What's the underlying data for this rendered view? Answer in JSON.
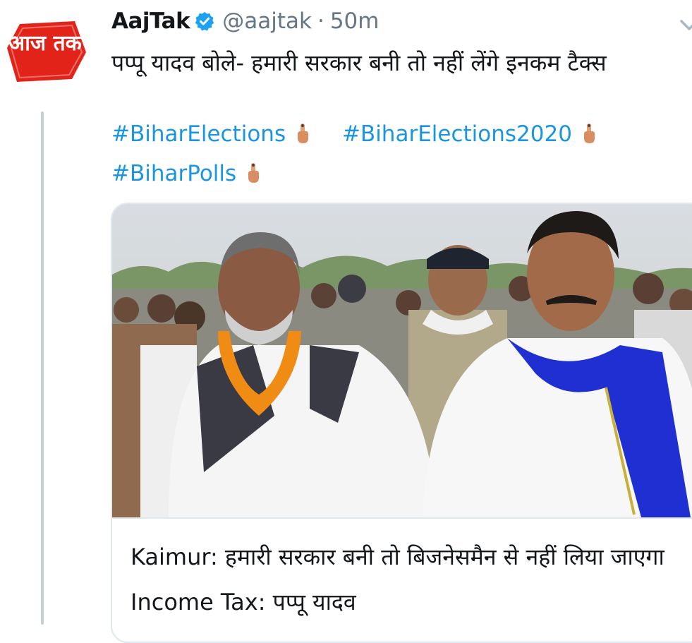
{
  "author": {
    "name": "AajTak",
    "handle": "@aajtak",
    "separator": "·",
    "time": "50m",
    "verified": true,
    "avatar_text": "आज तक",
    "avatar_color": "#e2231a"
  },
  "tweet": {
    "text": "पप्पू यादव बोले- हमारी सरकार बनी तो नहीं लेंगे इनकम टैक्स",
    "hashtags": [
      "#BiharElections",
      "#BiharElections2020",
      "#BiharPolls"
    ],
    "hashtag_icon": "index-finger-icon",
    "link_color": "#1b95e0"
  },
  "card": {
    "title": "Kaimur: हमारी सरकार बनी तो बिजनेसमैन से नहीं लिया जाएगा Income Tax: पप्पू यादव"
  },
  "icons": {
    "verified": "verified-badge-icon",
    "menu": "chevron-down-icon",
    "verified_color": "#1da1f2"
  }
}
